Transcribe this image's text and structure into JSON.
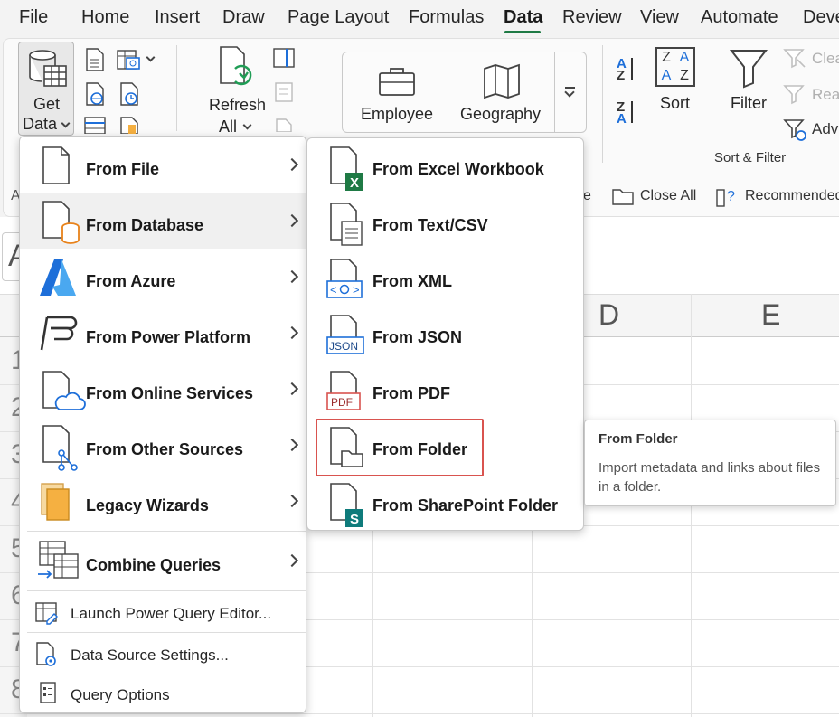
{
  "menubar": {
    "tabs": [
      "File",
      "Home",
      "Insert",
      "Draw",
      "Page Layout",
      "Formulas",
      "Data",
      "Review",
      "View",
      "Automate",
      "Deve"
    ],
    "active": "Data"
  },
  "ribbon": {
    "get_data_line1": "Get",
    "get_data_line2": "Data",
    "refresh_line1": "Refresh",
    "refresh_line2": "All",
    "gallery_employee": "Employee",
    "gallery_geography": "Geography",
    "sort_label": "Sort",
    "filter_label": "Filter",
    "clear_label": "Clea",
    "reapply_label": "Reap",
    "advanced_label": "Adv",
    "group_sort_filter": "Sort & Filter",
    "az_top": "A",
    "za_top": "Z",
    "sort_grid": [
      "Z",
      "A",
      "A",
      "Z"
    ],
    "row_partial_e": "e",
    "row_partial_a": "A",
    "close_all": "Close All",
    "recommended": "Recommended"
  },
  "sheet": {
    "name_box_partial": "A",
    "columns": [
      "D",
      "E"
    ],
    "row_numbers": [
      "1",
      "2",
      "3",
      "4",
      "5",
      "6",
      "7",
      "8"
    ]
  },
  "get_data_menu": {
    "items": [
      {
        "label": "From File"
      },
      {
        "label": "From Database"
      },
      {
        "label": "From Azure"
      },
      {
        "label": "From Power Platform"
      },
      {
        "label": "From Online Services"
      },
      {
        "label": "From Other Sources"
      },
      {
        "label": "Legacy Wizards"
      },
      {
        "label": "Combine Queries"
      }
    ],
    "plain_items": [
      {
        "label": "Launch Power Query Editor..."
      },
      {
        "label": "Data Source Settings..."
      },
      {
        "label": "Query Options"
      }
    ]
  },
  "database_submenu": {
    "items": [
      {
        "label": "From Excel Workbook",
        "badge": "X"
      },
      {
        "label": "From Text/CSV"
      },
      {
        "label": "From XML"
      },
      {
        "label": "From JSON",
        "badge": "JSON"
      },
      {
        "label": "From PDF",
        "badge": "PDF"
      },
      {
        "label": "From Folder"
      },
      {
        "label": "From SharePoint Folder",
        "badge": "S"
      }
    ],
    "highlighted": "From Folder"
  },
  "tooltip": {
    "title": "From Folder",
    "body": "Import metadata and links about files in a folder."
  },
  "colors": {
    "excel_green": "#1f7a45",
    "sharepoint_teal": "#0f7b7b",
    "highlight_red": "#d9534f",
    "azure_blue": "#1e6fd9",
    "db_orange": "#e8821a"
  }
}
